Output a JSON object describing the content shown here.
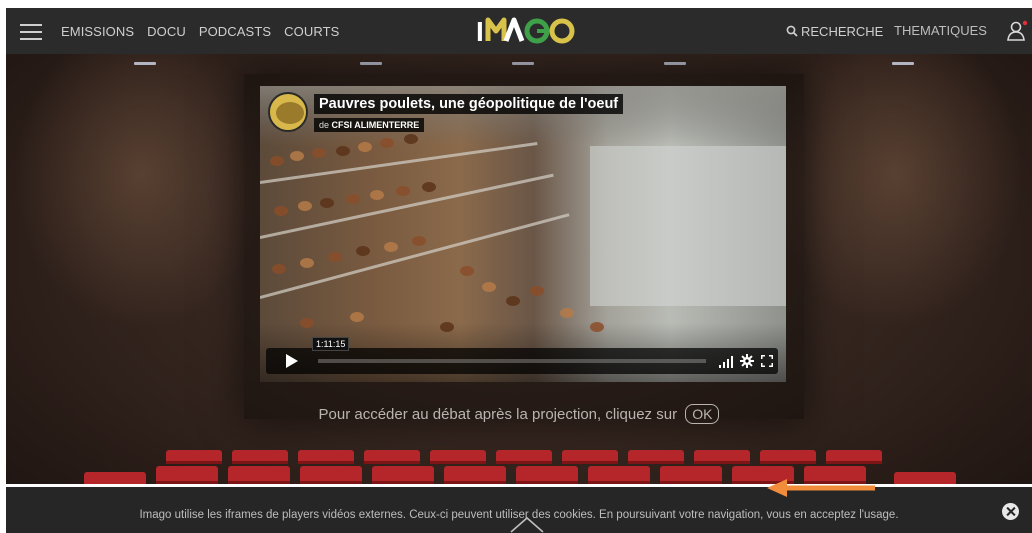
{
  "header": {
    "nav": [
      "EMISSIONS",
      "DOCU",
      "PODCASTS",
      "COURTS"
    ],
    "logo": "IMAGO",
    "search_label": "RECHERCHE",
    "themes_label": "THEMATIQUES",
    "icons": [
      "menu-icon",
      "search-icon",
      "user-icon"
    ]
  },
  "video": {
    "title": "Pauvres poulets, une géopolitique de l'oeuf",
    "byline_prefix": "de",
    "channel": "CFSI ALIMENTERRE",
    "timecode": "1:11:15",
    "progress": 0.0,
    "icons": [
      "play-icon",
      "volume-icon",
      "settings-gear-icon",
      "fullscreen-icon"
    ]
  },
  "prompt": {
    "text": "Pour accéder au débat après la projection, cliquez sur",
    "ok_label": "OK"
  },
  "cookie": {
    "text": "Imago utilise les iframes de players vidéos externes. Ceux-ci peuvent utiliser des cookies. En poursuivant votre navigation, vous en acceptez l'usage.",
    "icons": [
      "close-icon",
      "chevron-up-icon"
    ]
  },
  "colors": {
    "header_bg": "#2b2b2b",
    "cookie_bg": "#262626",
    "seat_red": "#b5262a",
    "logo_gold": "#d8c24a",
    "logo_green": "#3fa04a",
    "annotation_orange": "#f08c3a"
  }
}
